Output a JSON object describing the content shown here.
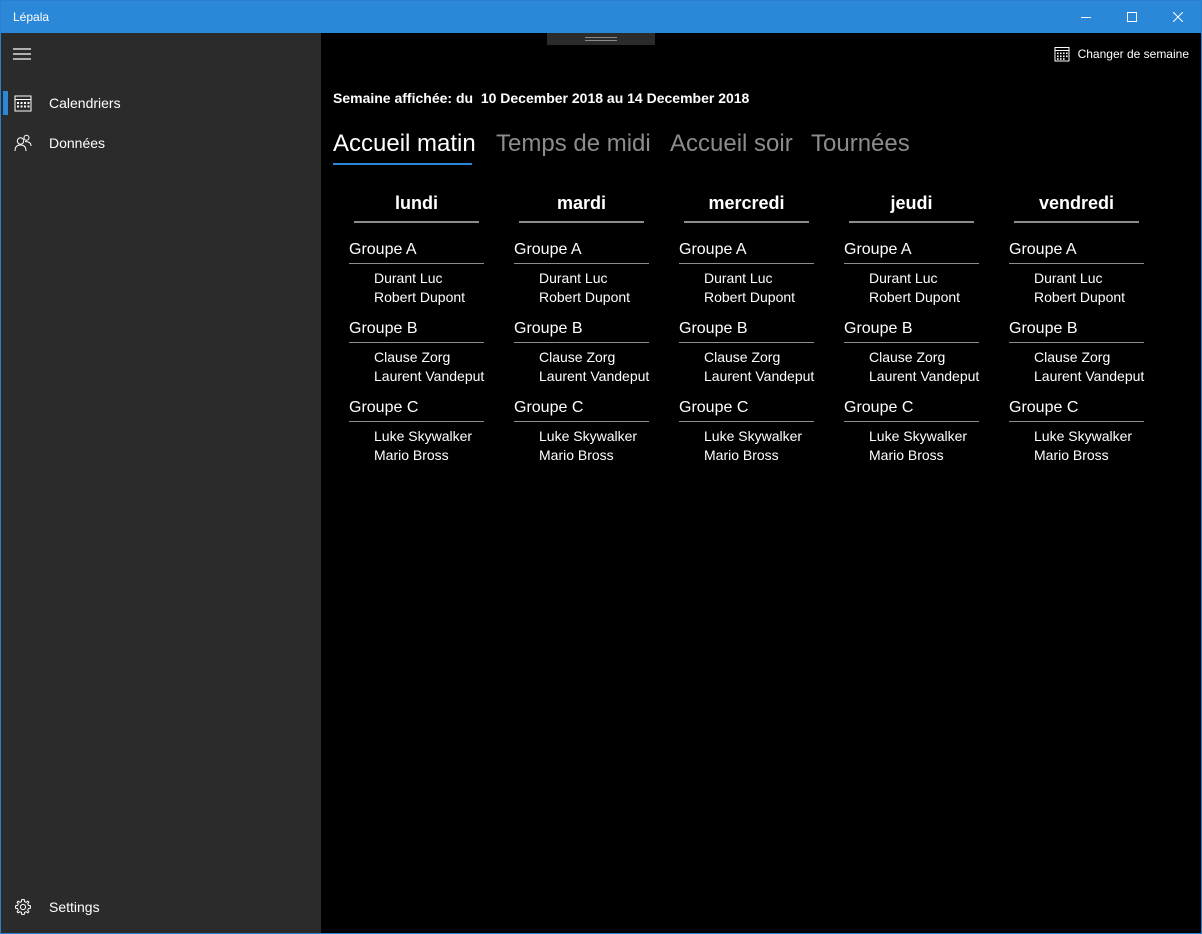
{
  "window": {
    "title": "Lépala",
    "controls": [
      "minimize-icon",
      "maximize-icon",
      "close-icon"
    ]
  },
  "sidebar": {
    "menu_icon": "hamburger-icon",
    "items": [
      {
        "label": "Calendriers",
        "icon": "calendar-icon",
        "selected": true
      },
      {
        "label": "Données",
        "icon": "people-icon",
        "selected": false
      }
    ],
    "settings": {
      "label": "Settings",
      "icon": "gear-icon"
    }
  },
  "toolbar": {
    "change_week_label": "Changer de semaine",
    "change_week_icon": "calendar-icon"
  },
  "week": {
    "line": "Semaine affichée: du  10 December 2018 au 14 December 2018"
  },
  "tabs": [
    {
      "label": "Accueil matin",
      "active": true
    },
    {
      "label": "Temps de midi",
      "active": false
    },
    {
      "label": "Accueil soir",
      "active": false
    },
    {
      "label": "Tournées",
      "active": false
    }
  ],
  "days": [
    {
      "name": "lundi",
      "groups": [
        {
          "name": "Groupe A",
          "members": [
            "Durant Luc",
            "Robert Dupont"
          ]
        },
        {
          "name": "Groupe B",
          "members": [
            "Clause Zorg",
            "Laurent Vandeput"
          ]
        },
        {
          "name": "Groupe C",
          "members": [
            "Luke Skywalker",
            "Mario Bross"
          ]
        }
      ]
    },
    {
      "name": "mardi",
      "groups": [
        {
          "name": "Groupe A",
          "members": [
            "Durant Luc",
            "Robert Dupont"
          ]
        },
        {
          "name": "Groupe B",
          "members": [
            "Clause Zorg",
            "Laurent Vandeput"
          ]
        },
        {
          "name": "Groupe C",
          "members": [
            "Luke Skywalker",
            "Mario Bross"
          ]
        }
      ]
    },
    {
      "name": "mercredi",
      "groups": [
        {
          "name": "Groupe A",
          "members": [
            "Durant Luc",
            "Robert Dupont"
          ]
        },
        {
          "name": "Groupe B",
          "members": [
            "Clause Zorg",
            "Laurent Vandeput"
          ]
        },
        {
          "name": "Groupe C",
          "members": [
            "Luke Skywalker",
            "Mario Bross"
          ]
        }
      ]
    },
    {
      "name": "jeudi",
      "groups": [
        {
          "name": "Groupe A",
          "members": [
            "Durant Luc",
            "Robert Dupont"
          ]
        },
        {
          "name": "Groupe B",
          "members": [
            "Clause Zorg",
            "Laurent Vandeput"
          ]
        },
        {
          "name": "Groupe C",
          "members": [
            "Luke Skywalker",
            "Mario Bross"
          ]
        }
      ]
    },
    {
      "name": "vendredi",
      "groups": [
        {
          "name": "Groupe A",
          "members": [
            "Durant Luc",
            "Robert Dupont"
          ]
        },
        {
          "name": "Groupe B",
          "members": [
            "Clause Zorg",
            "Laurent Vandeput"
          ]
        },
        {
          "name": "Groupe C",
          "members": [
            "Luke Skywalker",
            "Mario Bross"
          ]
        }
      ]
    }
  ],
  "colors": {
    "accent": "#2b88d8",
    "sidebar_bg": "#2b2b2b",
    "main_bg": "#000000",
    "inactive_tab": "#8c8c8c"
  }
}
